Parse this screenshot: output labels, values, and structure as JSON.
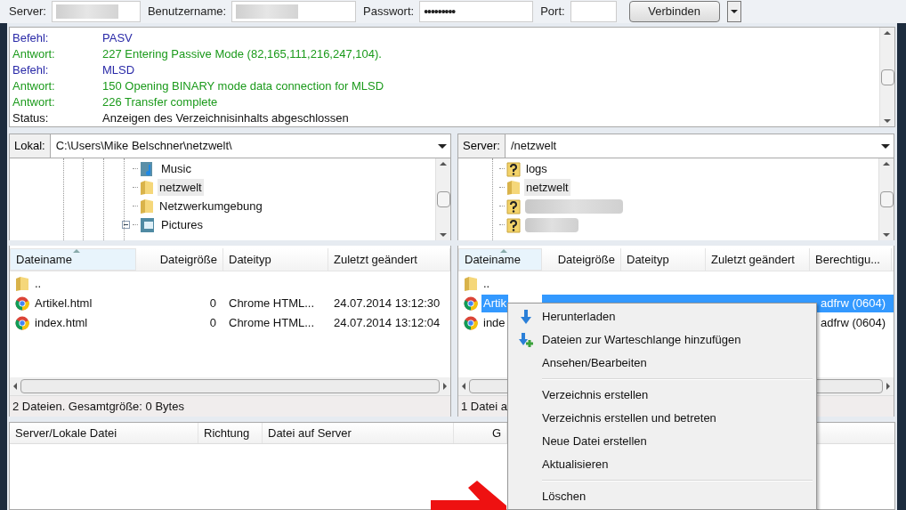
{
  "connection_bar": {
    "fields": [
      {
        "label": "Server:",
        "redacted": true
      },
      {
        "label": "Benutzername:",
        "redacted": true
      },
      {
        "label": "Passwort:",
        "value": "•••••••••",
        "redacted": false
      },
      {
        "label": "Port:",
        "redacted": false
      }
    ],
    "connect_button": "Verbinden"
  },
  "log": [
    {
      "kind": "command",
      "label": "Befehl:",
      "message": "PASV"
    },
    {
      "kind": "response",
      "label": "Antwort:",
      "message": "227 Entering Passive Mode (82,165,111,216,247,104)."
    },
    {
      "kind": "command",
      "label": "Befehl:",
      "message": "MLSD"
    },
    {
      "kind": "response",
      "label": "Antwort:",
      "message": "150 Opening BINARY mode data connection for MLSD"
    },
    {
      "kind": "response",
      "label": "Antwort:",
      "message": "226 Transfer complete"
    },
    {
      "kind": "status",
      "label": "Status:",
      "message": "Anzeigen des Verzeichnisinhalts abgeschlossen"
    }
  ],
  "local": {
    "label": "Lokal:",
    "path": "C:\\Users\\Mike Belschner\\netzwelt\\",
    "tree": [
      {
        "kind": "music",
        "name": "Music",
        "selected": false,
        "expandable": false
      },
      {
        "kind": "folder",
        "name": "netzwelt",
        "selected": true,
        "expandable": false
      },
      {
        "kind": "folder",
        "name": "Netzwerkumgebung",
        "selected": false,
        "expandable": false
      },
      {
        "kind": "pictures",
        "name": "Pictures",
        "selected": false,
        "expandable": true
      }
    ],
    "columns": [
      "Dateiname",
      "Dateigröße",
      "Dateityp",
      "Zuletzt geändert"
    ],
    "rows": [
      {
        "kind": "parent",
        "name": "..",
        "selected": false
      },
      {
        "kind": "html",
        "name": "Artikel.html",
        "size": "0",
        "type": "Chrome HTML...",
        "modified": "24.07.2014 13:12:30",
        "selected": false
      },
      {
        "kind": "html",
        "name": "index.html",
        "size": "0",
        "type": "Chrome HTML...",
        "modified": "24.07.2014 13:12:04",
        "selected": false
      }
    ],
    "status": "2 Dateien. Gesamtgröße: 0 Bytes"
  },
  "remote": {
    "label": "Server:",
    "path": "/netzwelt",
    "tree": [
      {
        "kind": "unknown",
        "name": "logs",
        "selected": false
      },
      {
        "kind": "folder",
        "name": "netzwelt",
        "selected": true
      },
      {
        "kind": "unknown",
        "redacted": true,
        "selected": false
      },
      {
        "kind": "unknown",
        "redacted": true,
        "selected": false
      }
    ],
    "columns": [
      "Dateiname",
      "Dateigröße",
      "Dateityp",
      "Zuletzt geändert",
      "Berechtigu..."
    ],
    "rows": [
      {
        "kind": "parent",
        "name": "..",
        "selected": false
      },
      {
        "kind": "html",
        "name": "Artik",
        "permissions": "adfrw (0604)",
        "selected": true
      },
      {
        "kind": "html",
        "name": "inde",
        "permissions": "adfrw (0604)",
        "selected": false
      }
    ],
    "status": "1 Datei a"
  },
  "queue": {
    "columns": [
      "Server/Lokale Datei",
      "Richtung",
      "Datei auf Server",
      "G"
    ]
  },
  "context_menu": [
    {
      "kind": "download",
      "label": "Herunterladen"
    },
    {
      "kind": "queue",
      "label": "Dateien zur Warteschlange hinzufügen"
    },
    {
      "kind": "item",
      "label": "Ansehen/Bearbeiten"
    },
    {
      "kind": "separator"
    },
    {
      "kind": "item",
      "label": "Verzeichnis erstellen"
    },
    {
      "kind": "item",
      "label": "Verzeichnis erstellen und betreten"
    },
    {
      "kind": "item",
      "label": "Neue Datei erstellen"
    },
    {
      "kind": "item",
      "label": "Aktualisieren"
    },
    {
      "kind": "separator"
    },
    {
      "kind": "item",
      "label": "Löschen"
    }
  ]
}
